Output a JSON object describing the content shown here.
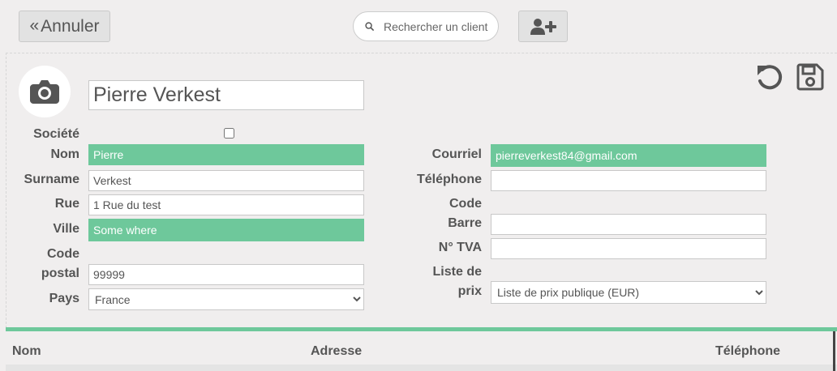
{
  "header": {
    "cancel_label": "Annuler",
    "search_placeholder": "Rechercher un client"
  },
  "customer": {
    "name": "Pierre Verkest"
  },
  "form": {
    "labels": {
      "societe": "Société",
      "nom": "Nom",
      "surname": "Surname",
      "rue": "Rue",
      "ville": "Ville",
      "code_postal_line1": "Code",
      "code_postal_line2": "postal",
      "pays": "Pays",
      "courriel": "Courriel",
      "telephone": "Téléphone",
      "code_barre_line1": "Code",
      "code_barre_line2": "Barre",
      "tva": "N° TVA",
      "liste_prix_line1": "Liste de",
      "liste_prix_line2": "prix"
    },
    "values": {
      "societe_checked": false,
      "nom": "Pierre",
      "surname": "Verkest",
      "rue": "1 Rue du test",
      "ville": "Some where",
      "code_postal": "99999",
      "pays": "France",
      "courriel": "pierreverkest84@gmail.com",
      "telephone": "",
      "code_barre": "",
      "tva": "",
      "liste_prix": "Liste de prix publique (EUR)"
    }
  },
  "table": {
    "headers": [
      "Nom",
      "Adresse",
      "Téléphone"
    ]
  },
  "colors": {
    "accent_green": "#6ec89b",
    "background": "#f0eeee"
  },
  "icons": {
    "cancel": "double-chevron-left-icon",
    "search": "search-icon",
    "add_user": "user-plus-icon",
    "avatar": "camera-icon",
    "undo": "undo-icon",
    "save": "save-icon"
  }
}
